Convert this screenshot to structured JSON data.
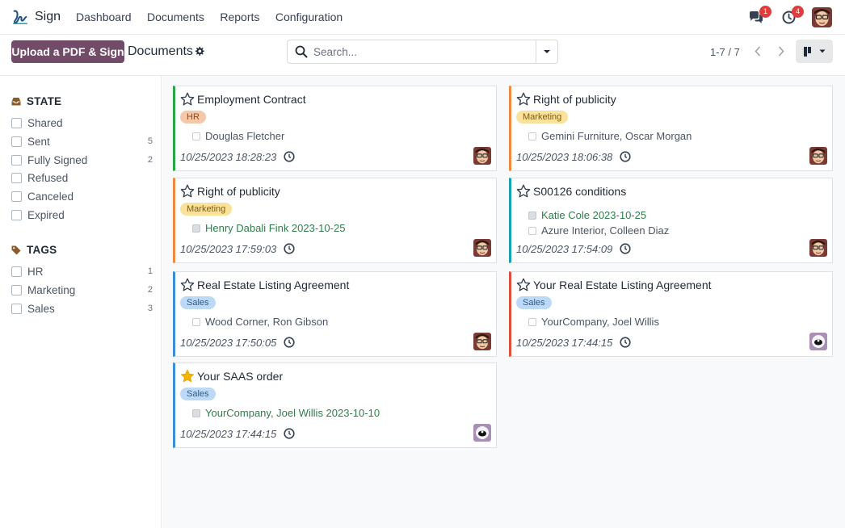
{
  "navbar": {
    "app_name": "Sign",
    "menu": [
      "Dashboard",
      "Documents",
      "Reports",
      "Configuration"
    ],
    "messages_count": "1",
    "activities_count": "4"
  },
  "control": {
    "upload_label": "Upload a PDF & Sign",
    "title": "Documents",
    "search_placeholder": "Search...",
    "pager": "1-7 / 7"
  },
  "sidebar": {
    "state_title": "STATE",
    "states": [
      {
        "label": "Shared",
        "count": ""
      },
      {
        "label": "Sent",
        "count": "5"
      },
      {
        "label": "Fully Signed",
        "count": "2"
      },
      {
        "label": "Refused",
        "count": ""
      },
      {
        "label": "Canceled",
        "count": ""
      },
      {
        "label": "Expired",
        "count": ""
      }
    ],
    "tags_title": "TAGS",
    "tags": [
      {
        "label": "HR",
        "count": "1"
      },
      {
        "label": "Marketing",
        "count": "2"
      },
      {
        "label": "Sales",
        "count": "3"
      }
    ]
  },
  "cards": [
    {
      "title": "Employment Contract",
      "tag": "HR",
      "signers": [
        {
          "text": "Douglas Fletcher",
          "signed": false
        }
      ],
      "date": "10/25/2023 18:28:23",
      "starred": false
    },
    {
      "title": "Right of publicity",
      "tag": "Marketing",
      "signers": [
        {
          "text": "Gemini Furniture, Oscar Morgan",
          "signed": false
        }
      ],
      "date": "10/25/2023 18:06:38",
      "starred": false
    },
    {
      "title": "Right of publicity",
      "tag": "Marketing",
      "signers": [
        {
          "text": "Henry Dabali Fink 2023-10-25",
          "signed": true
        }
      ],
      "date": "10/25/2023 17:59:03",
      "starred": false
    },
    {
      "title": "S00126 conditions",
      "tag": "",
      "signers": [
        {
          "text": "Katie Cole 2023-10-25",
          "signed": true
        },
        {
          "text": "Azure Interior, Colleen Diaz",
          "signed": false
        }
      ],
      "date": "10/25/2023 17:54:09",
      "starred": false
    },
    {
      "title": "Real Estate Listing Agreement",
      "tag": "Sales",
      "signers": [
        {
          "text": "Wood Corner, Ron Gibson",
          "signed": false
        }
      ],
      "date": "10/25/2023 17:50:05",
      "starred": false
    },
    {
      "title": "Your Real Estate Listing Agreement",
      "tag": "Sales",
      "signers": [
        {
          "text": "YourCompany, Joel Willis",
          "signed": false
        }
      ],
      "date": "10/25/2023 17:44:15",
      "starred": false
    },
    {
      "title": "Your SAAS order",
      "tag": "Sales",
      "signers": [
        {
          "text": "YourCompany, Joel Willis 2023-10-10",
          "signed": true
        }
      ],
      "date": "10/25/2023 17:44:15",
      "starred": true
    }
  ],
  "colors": {
    "brand": "#714b67",
    "badge": "#e23b3b",
    "signed_text": "#2e7d4a",
    "star_active": "#f3b500"
  }
}
